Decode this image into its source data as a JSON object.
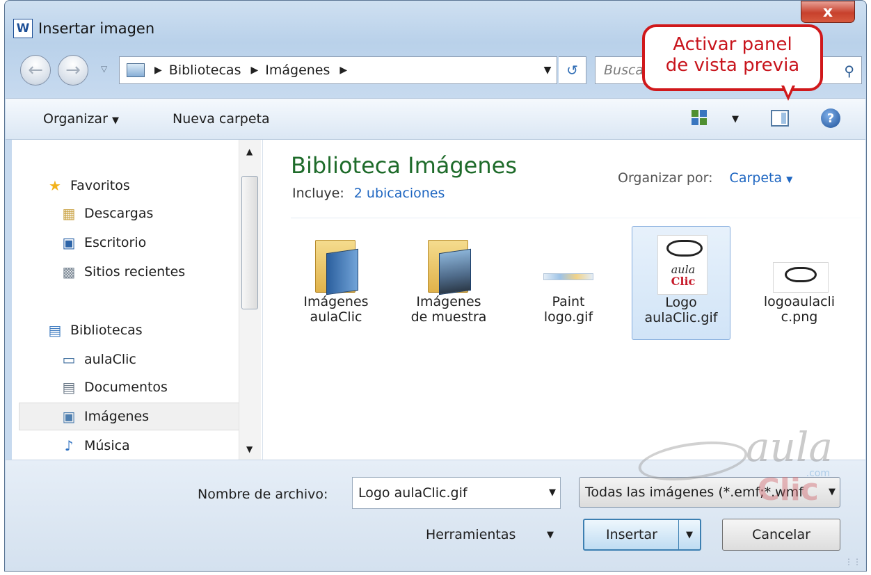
{
  "window": {
    "title": "Insertar imagen",
    "app_icon": "W",
    "close_label": "x"
  },
  "nav": {
    "back_icon": "back-arrow-icon",
    "forward_icon": "forward-arrow-icon",
    "breadcrumb": [
      "Bibliotecas",
      "Imágenes"
    ],
    "search_placeholder": "Buscar Imágenes"
  },
  "callout": {
    "line1": "Activar panel",
    "line2": "de vista previa"
  },
  "toolbar": {
    "organize": "Organizar",
    "new_folder": "Nueva carpeta"
  },
  "sidebar": {
    "items": [
      {
        "label": "Favoritos",
        "icon": "star-icon"
      },
      {
        "label": "Descargas",
        "icon": "downloads-icon"
      },
      {
        "label": "Escritorio",
        "icon": "desktop-icon"
      },
      {
        "label": "Sitios recientes",
        "icon": "recent-places-icon"
      },
      {
        "label": "Bibliotecas",
        "icon": "libraries-icon"
      },
      {
        "label": "aulaClic",
        "icon": "library-icon"
      },
      {
        "label": "Documentos",
        "icon": "documents-icon"
      },
      {
        "label": "Imágenes",
        "icon": "pictures-icon",
        "selected": true
      },
      {
        "label": "Música",
        "icon": "music-icon"
      }
    ]
  },
  "main": {
    "title": "Biblioteca Imágenes",
    "includes_label": "Incluye:",
    "includes_link": "2 ubicaciones",
    "arrange_label": "Organizar por:",
    "arrange_value": "Carpeta",
    "files": [
      {
        "line1": "Imágenes",
        "line2": "aulaClic",
        "kind": "folder"
      },
      {
        "line1": "Imágenes",
        "line2": "de muestra",
        "kind": "folder"
      },
      {
        "line1": "Paint",
        "line2": "logo.gif",
        "kind": "image"
      },
      {
        "line1": "Logo",
        "line2": "aulaClic.gif",
        "kind": "image",
        "selected": true
      },
      {
        "line1": "logoaulacli",
        "line2": "c.png",
        "kind": "image"
      }
    ]
  },
  "bottom": {
    "filename_label": "Nombre de archivo:",
    "filename_value": "Logo aulaClic.gif",
    "filetype_value": "Todas las imágenes (*.emf;*.wmf",
    "tools_label": "Herramientas",
    "insert_label": "Insertar",
    "cancel_label": "Cancelar"
  },
  "watermark": {
    "aula": "aula",
    "clic": "Clic",
    "com": ".com"
  },
  "colors": {
    "accent": "#1e66c1",
    "title_green": "#1e6b2a",
    "callout_red": "#d0181b"
  }
}
